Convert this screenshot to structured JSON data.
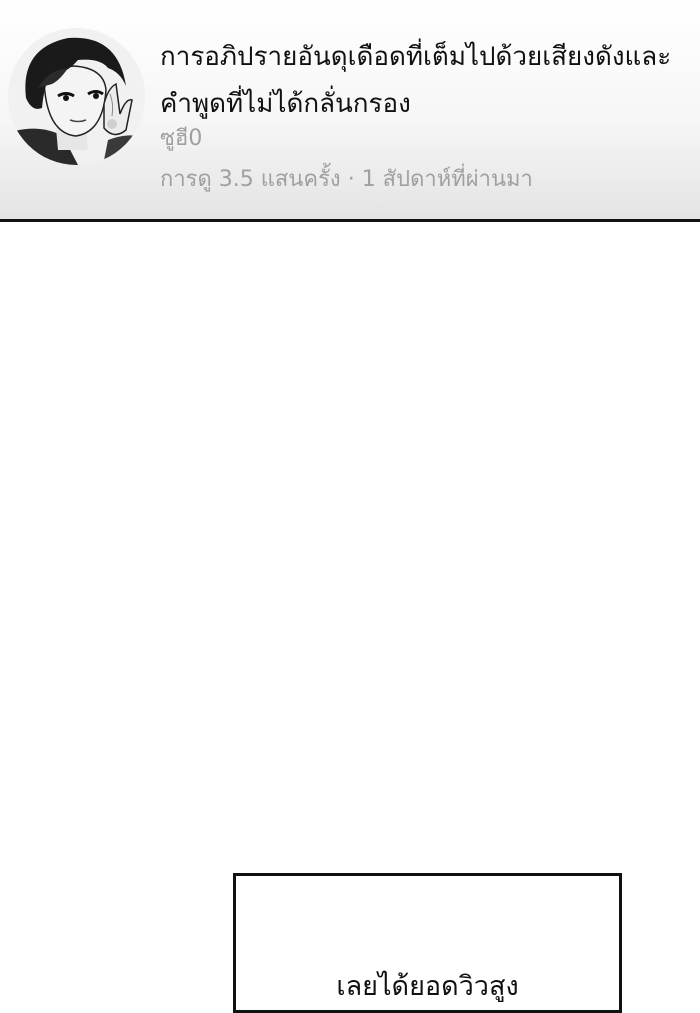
{
  "video": {
    "title": "การอภิปรายอันดุเดือดที่เต็มไปด้วยเสียงดังและคำพูดที่ไม่ได้กลั่นกรอง",
    "channel": "ซูฮี0",
    "views": "การดู 3.5 แสนครั้ง",
    "separator": "·",
    "age": "1 สัปดาห์ที่ผ่านมา",
    "avatar_icon": "channel-avatar-manga-girl"
  },
  "caption": {
    "text": "เลยได้ยอดวิวสูง"
  }
}
